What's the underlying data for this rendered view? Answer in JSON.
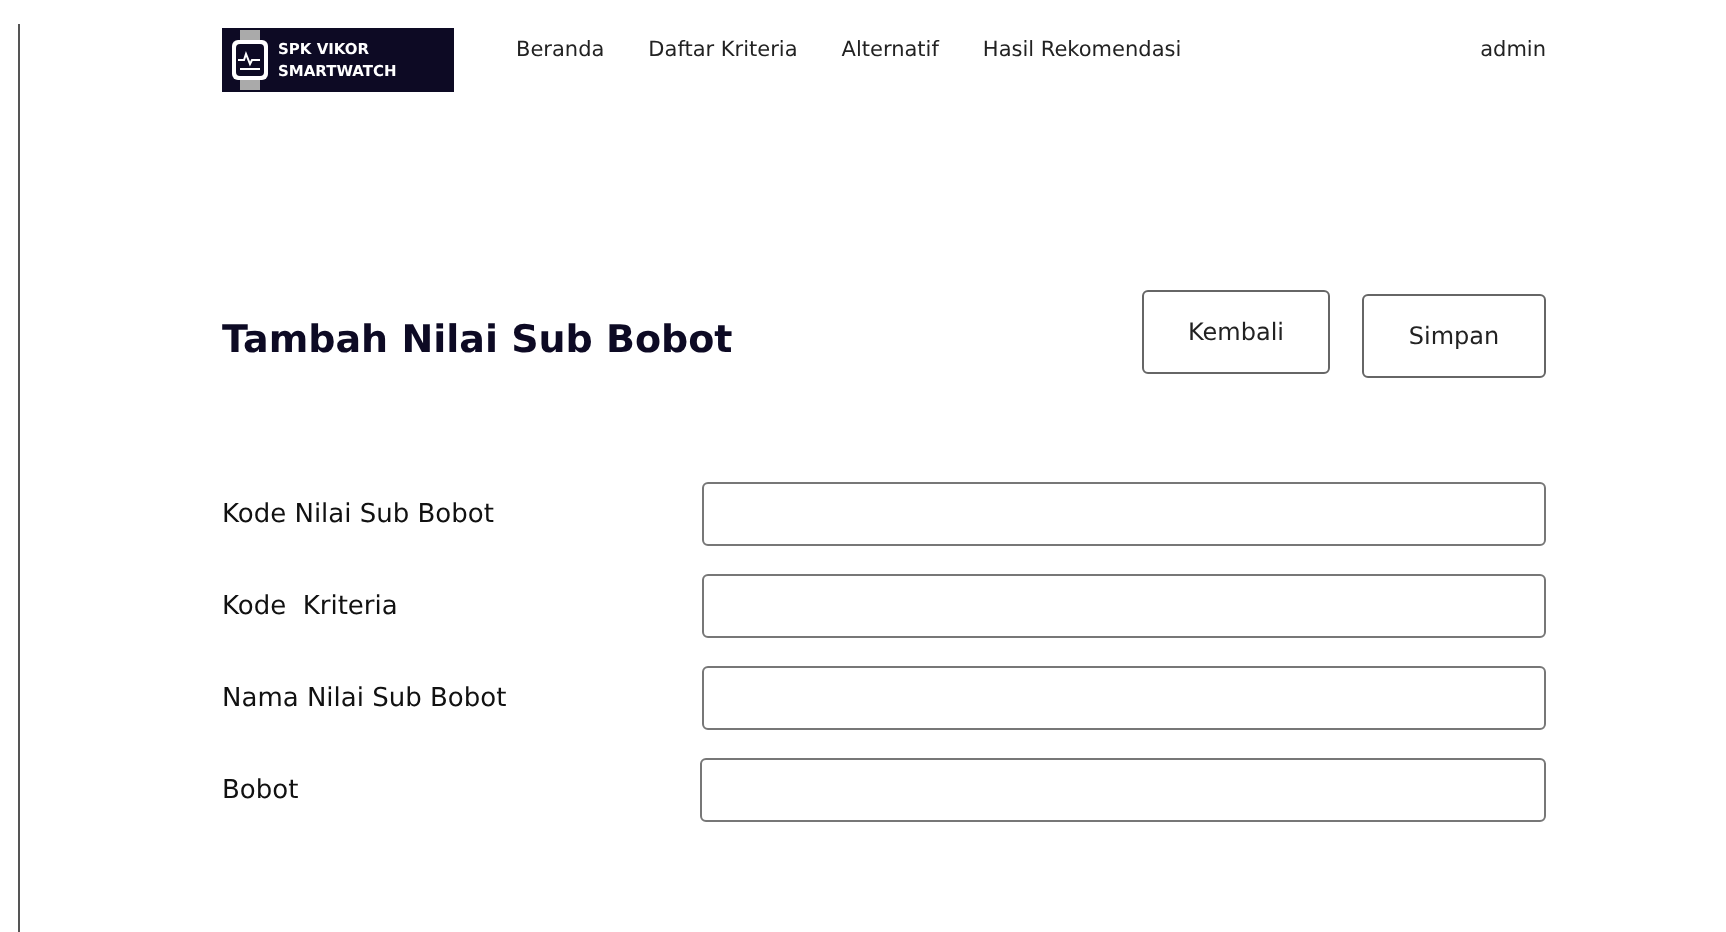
{
  "logo": {
    "lines": [
      "SPK VIKOR",
      "SMARTWATCH"
    ]
  },
  "nav": {
    "links": [
      "Beranda",
      "Daftar Kriteria",
      "Alternatif",
      "Hasil Rekomendasi"
    ],
    "user": "admin"
  },
  "page": {
    "title": "Tambah Nilai Sub Bobot",
    "buttons": [
      "Kembali",
      "Simpan"
    ]
  },
  "form": {
    "fields": [
      {
        "label": "Kode Nilai Sub Bobot"
      },
      {
        "label": "Kode  Kriteria"
      },
      {
        "label": "Nama Nilai Sub Bobot"
      },
      {
        "label": "Bobot"
      }
    ]
  }
}
